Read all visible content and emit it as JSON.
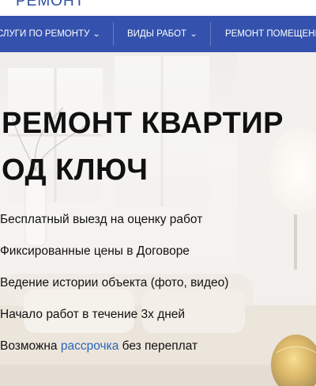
{
  "header": {
    "logo_text": "РЕМОНТ"
  },
  "nav": {
    "items": [
      {
        "label": "СЛУГИ ПО РЕМОНТУ",
        "chevron": "chevron-down-icon"
      },
      {
        "label": "ВИДЫ РАБОТ",
        "chevron": "chevron-down-icon"
      },
      {
        "label": "РЕМОНТ ПОМЕЩЕНИ"
      }
    ]
  },
  "hero": {
    "title_line1": "РЕМОНТ КВАРТИР",
    "title_line2": "ОД КЛЮЧ",
    "bullets": [
      "Бесплатный выезд на оценку работ",
      "Фиксированные цены в Договоре",
      "Ведение истории объекта (фото, видео)",
      "Начало работ в течение 3х дней"
    ],
    "last_bullet": {
      "before": "Возможна ",
      "link": "рассрочка",
      "after": " без переплат"
    }
  },
  "colors": {
    "nav_bg": "#3452ad",
    "link": "#2a66b8",
    "logo": "#2d4ea3"
  }
}
